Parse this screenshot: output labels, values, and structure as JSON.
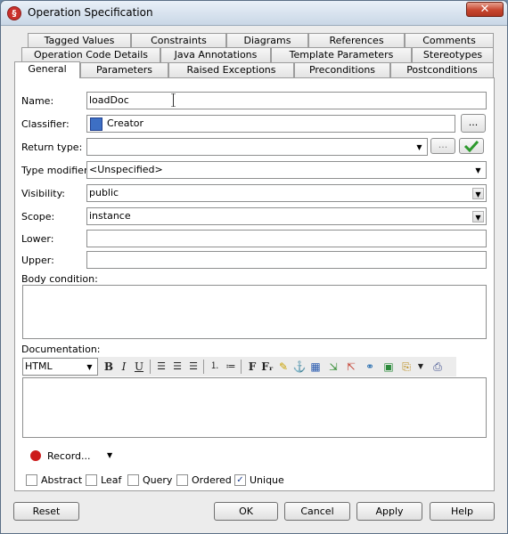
{
  "window": {
    "title": "Operation Specification",
    "app_icon_glyph": "§",
    "close_glyph": "✕"
  },
  "tabs": {
    "row1": [
      "Tagged Values",
      "Constraints",
      "Diagrams",
      "References",
      "Comments"
    ],
    "row2": [
      "Operation Code Details",
      "Java Annotations",
      "Template Parameters",
      "Stereotypes"
    ],
    "row3": [
      "General",
      "Parameters",
      "Raised Exceptions",
      "Preconditions",
      "Postconditions"
    ],
    "active": "General"
  },
  "form": {
    "name_label": "Name:",
    "name_value": "loadDoc",
    "classifier_label": "Classifier:",
    "classifier_value": "Creator",
    "classifier_browse": "...",
    "return_type_label": "Return type:",
    "return_type_value": "",
    "return_type_browse": "...",
    "type_modifier_label": "Type modifier:",
    "type_modifier_value": "<Unspecified>",
    "visibility_label": "Visibility:",
    "visibility_value": "public",
    "scope_label": "Scope:",
    "scope_value": "instance",
    "lower_label": "Lower:",
    "lower_value": "",
    "upper_label": "Upper:",
    "upper_value": "",
    "body_condition_label": "Body condition:",
    "documentation_label": "Documentation:"
  },
  "doc_toolbar": {
    "format_value": "HTML",
    "bold": "B",
    "italic": "I",
    "underline": "U",
    "font_glyph": "F",
    "font_size_glyph": "Fᵣ"
  },
  "record": {
    "label": "Record..."
  },
  "checkboxes": [
    {
      "label": "Abstract",
      "checked": false
    },
    {
      "label": "Leaf",
      "checked": false
    },
    {
      "label": "Query",
      "checked": false
    },
    {
      "label": "Ordered",
      "checked": false
    },
    {
      "label": "Unique",
      "checked": true
    }
  ],
  "buttons": {
    "reset": "Reset",
    "ok": "OK",
    "cancel": "Cancel",
    "apply": "Apply",
    "help": "Help"
  },
  "colors": {
    "record_dot": "#cc1a1a",
    "confirm_green": "#2e9a2e",
    "classifier_icon": "#3d6fc4"
  }
}
